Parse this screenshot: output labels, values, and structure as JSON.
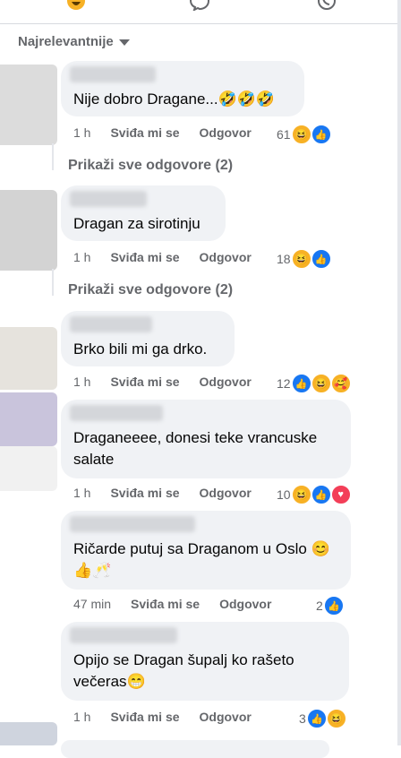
{
  "sort_label": "Najrelevantnije",
  "comments": [
    {
      "text": "Nije dobro Dragane...🤣🤣🤣",
      "time": "1 h",
      "like": "Sviđa mi se",
      "reply": "Odgovor",
      "reactions": "61"
    },
    {
      "text": "Dragan za sirotinju",
      "time": "1 h",
      "like": "Sviđa mi se",
      "reply": "Odgovor",
      "reactions": "18"
    },
    {
      "text": "Brko bili mi ga drko.",
      "time": "1 h",
      "like": "Sviđa mi se",
      "reply": "Odgovor",
      "reactions": "12"
    },
    {
      "text": "Draganeeee, donesi teke vrancuske salate",
      "time": "1 h",
      "like": "Sviđa mi se",
      "reply": "Odgovor",
      "reactions": "10"
    },
    {
      "text": "Ričarde putuj sa Draganom u Oslo 😊👍🥂",
      "time": "47 min",
      "like": "Sviđa mi se",
      "reply": "Odgovor",
      "reactions": "2"
    },
    {
      "text": "Opijo se Dragan šupalj ko rašeto večeras😁",
      "time": "1 h",
      "like": "Sviđa mi se",
      "reply": "Odgovor",
      "reactions": "3"
    }
  ],
  "show_replies": [
    "Prikaži sve odgovore (2)",
    "Prikaži sve odgovore (2)"
  ],
  "colors": {
    "bubble": "#f0f2f5",
    "like": "#1877f2",
    "meta": "#65676b"
  },
  "icons": [
    "haha-reaction-icon",
    "comment-icon",
    "whatsapp-icon",
    "like-reaction-icon",
    "love-reaction-icon",
    "care-reaction-icon"
  ]
}
